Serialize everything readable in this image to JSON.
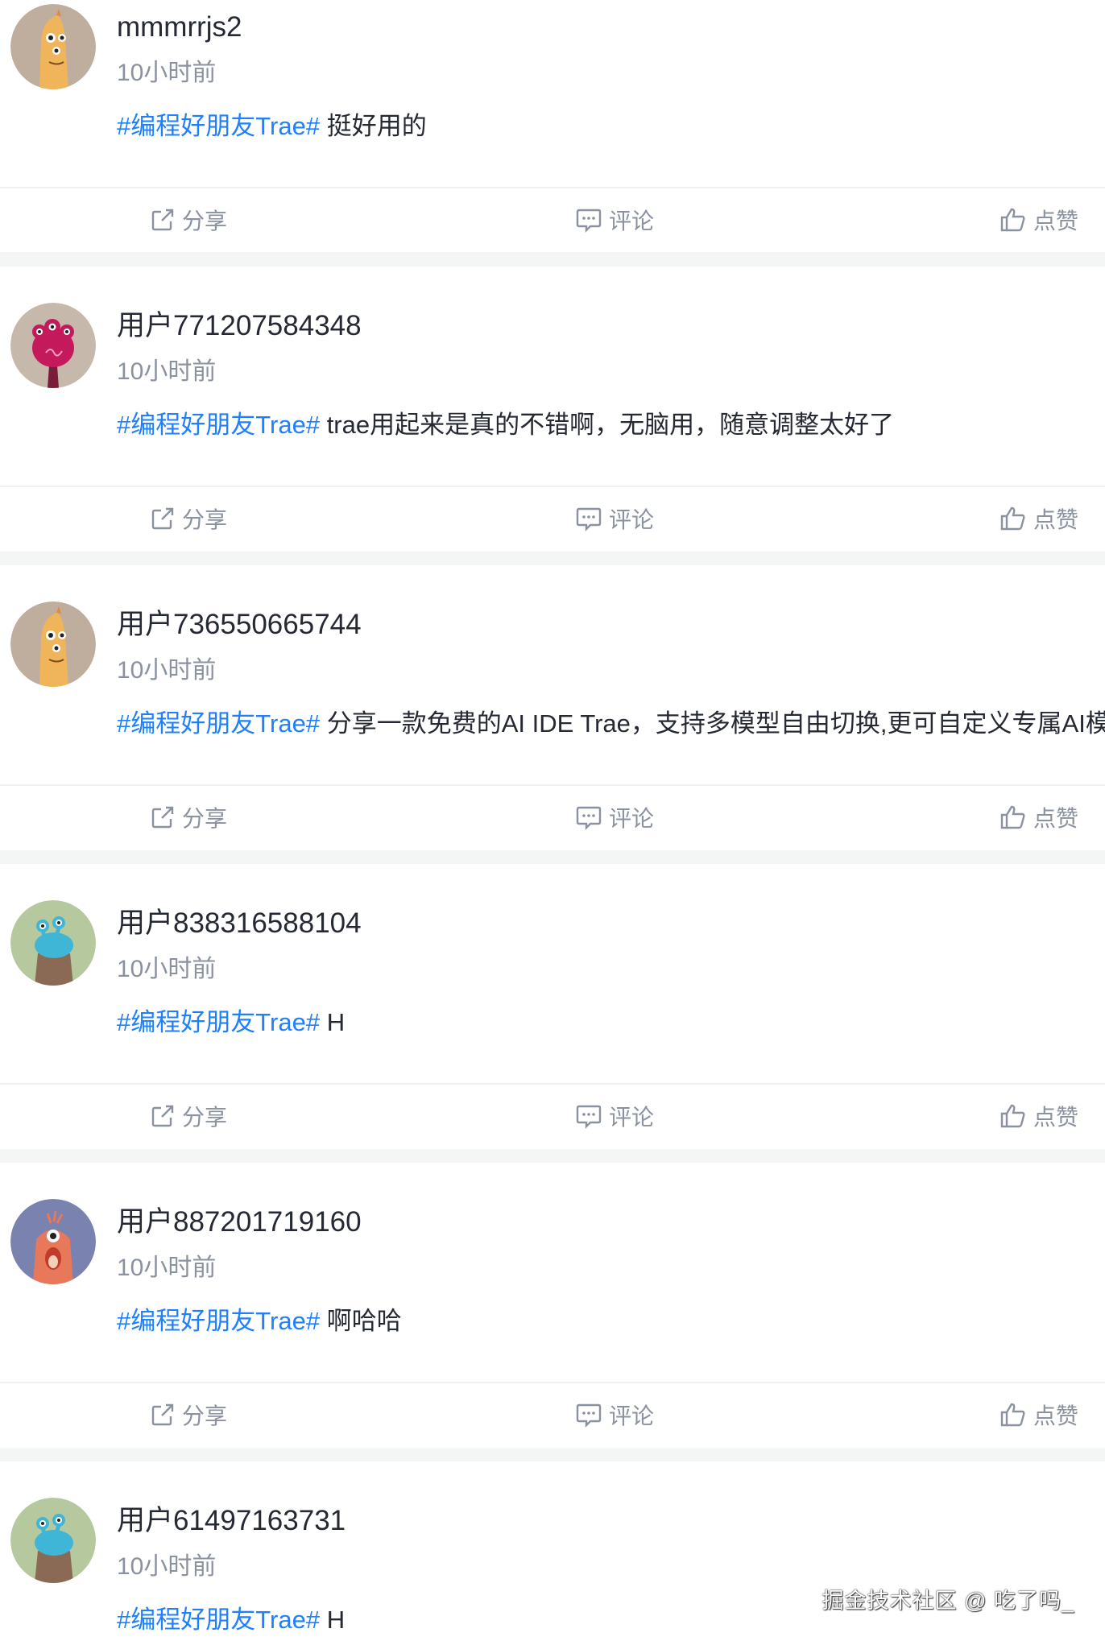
{
  "posts": [
    {
      "username": "mmmrrjs2",
      "time": "10小时前",
      "topic": "#编程好朋友Trae#",
      "text": " 挺好用的",
      "avatar": "orange-creature-avatar"
    },
    {
      "username": "用户771207584348",
      "time": "10小时前",
      "topic": "#编程好朋友Trae#",
      "text": " trae用起来是真的不错啊，无脑用，随意调整太好了",
      "avatar": "magenta-creature-avatar"
    },
    {
      "username": "用户736550665744",
      "time": "10小时前",
      "topic": "#编程好朋友Trae#",
      "text": " 分享一款免费的AI IDE Trae，支持多模型自由切换,更可自定义专属AI模",
      "avatar": "orange-creature-avatar"
    },
    {
      "username": "用户838316588104",
      "time": "10小时前",
      "topic": "#编程好朋友Trae#",
      "text": " H",
      "avatar": "teal-creature-avatar"
    },
    {
      "username": "用户887201719160",
      "time": "10小时前",
      "topic": "#编程好朋友Trae#",
      "text": " 啊哈哈",
      "avatar": "coral-creature-avatar"
    },
    {
      "username": "用户61497163731",
      "time": "10小时前",
      "topic": "#编程好朋友Trae#",
      "text": " H",
      "avatar": "teal-creature-avatar"
    }
  ],
  "actions": {
    "share": "分享",
    "comment": "评论",
    "like": "点赞"
  },
  "watermark": "掘金技术社区 @ 吃了吗_",
  "colors": {
    "topic": "#1e80ff",
    "text": "#252933",
    "muted": "#8a919f",
    "background": "#f4f5f5"
  }
}
